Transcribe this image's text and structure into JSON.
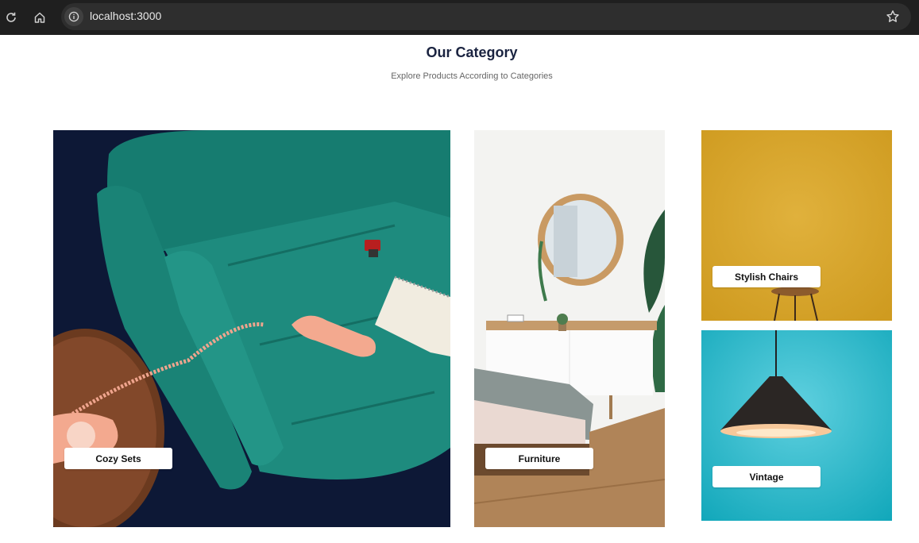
{
  "browser": {
    "url": "localhost:3000"
  },
  "header": {
    "title": "Our Category",
    "subtitle": "Explore Products According to Categories"
  },
  "categories": [
    {
      "label": "Cozy Sets"
    },
    {
      "label": "Furniture"
    },
    {
      "label": "Stylish Chairs"
    },
    {
      "label": "Vintage"
    }
  ],
  "colors": {
    "title": "#1a2340",
    "sofa_teal": "#1e8b7e",
    "navy_bg": "#0d1836",
    "mustard_bg": "#d8a52c",
    "cyan_bg": "#33bccf"
  }
}
